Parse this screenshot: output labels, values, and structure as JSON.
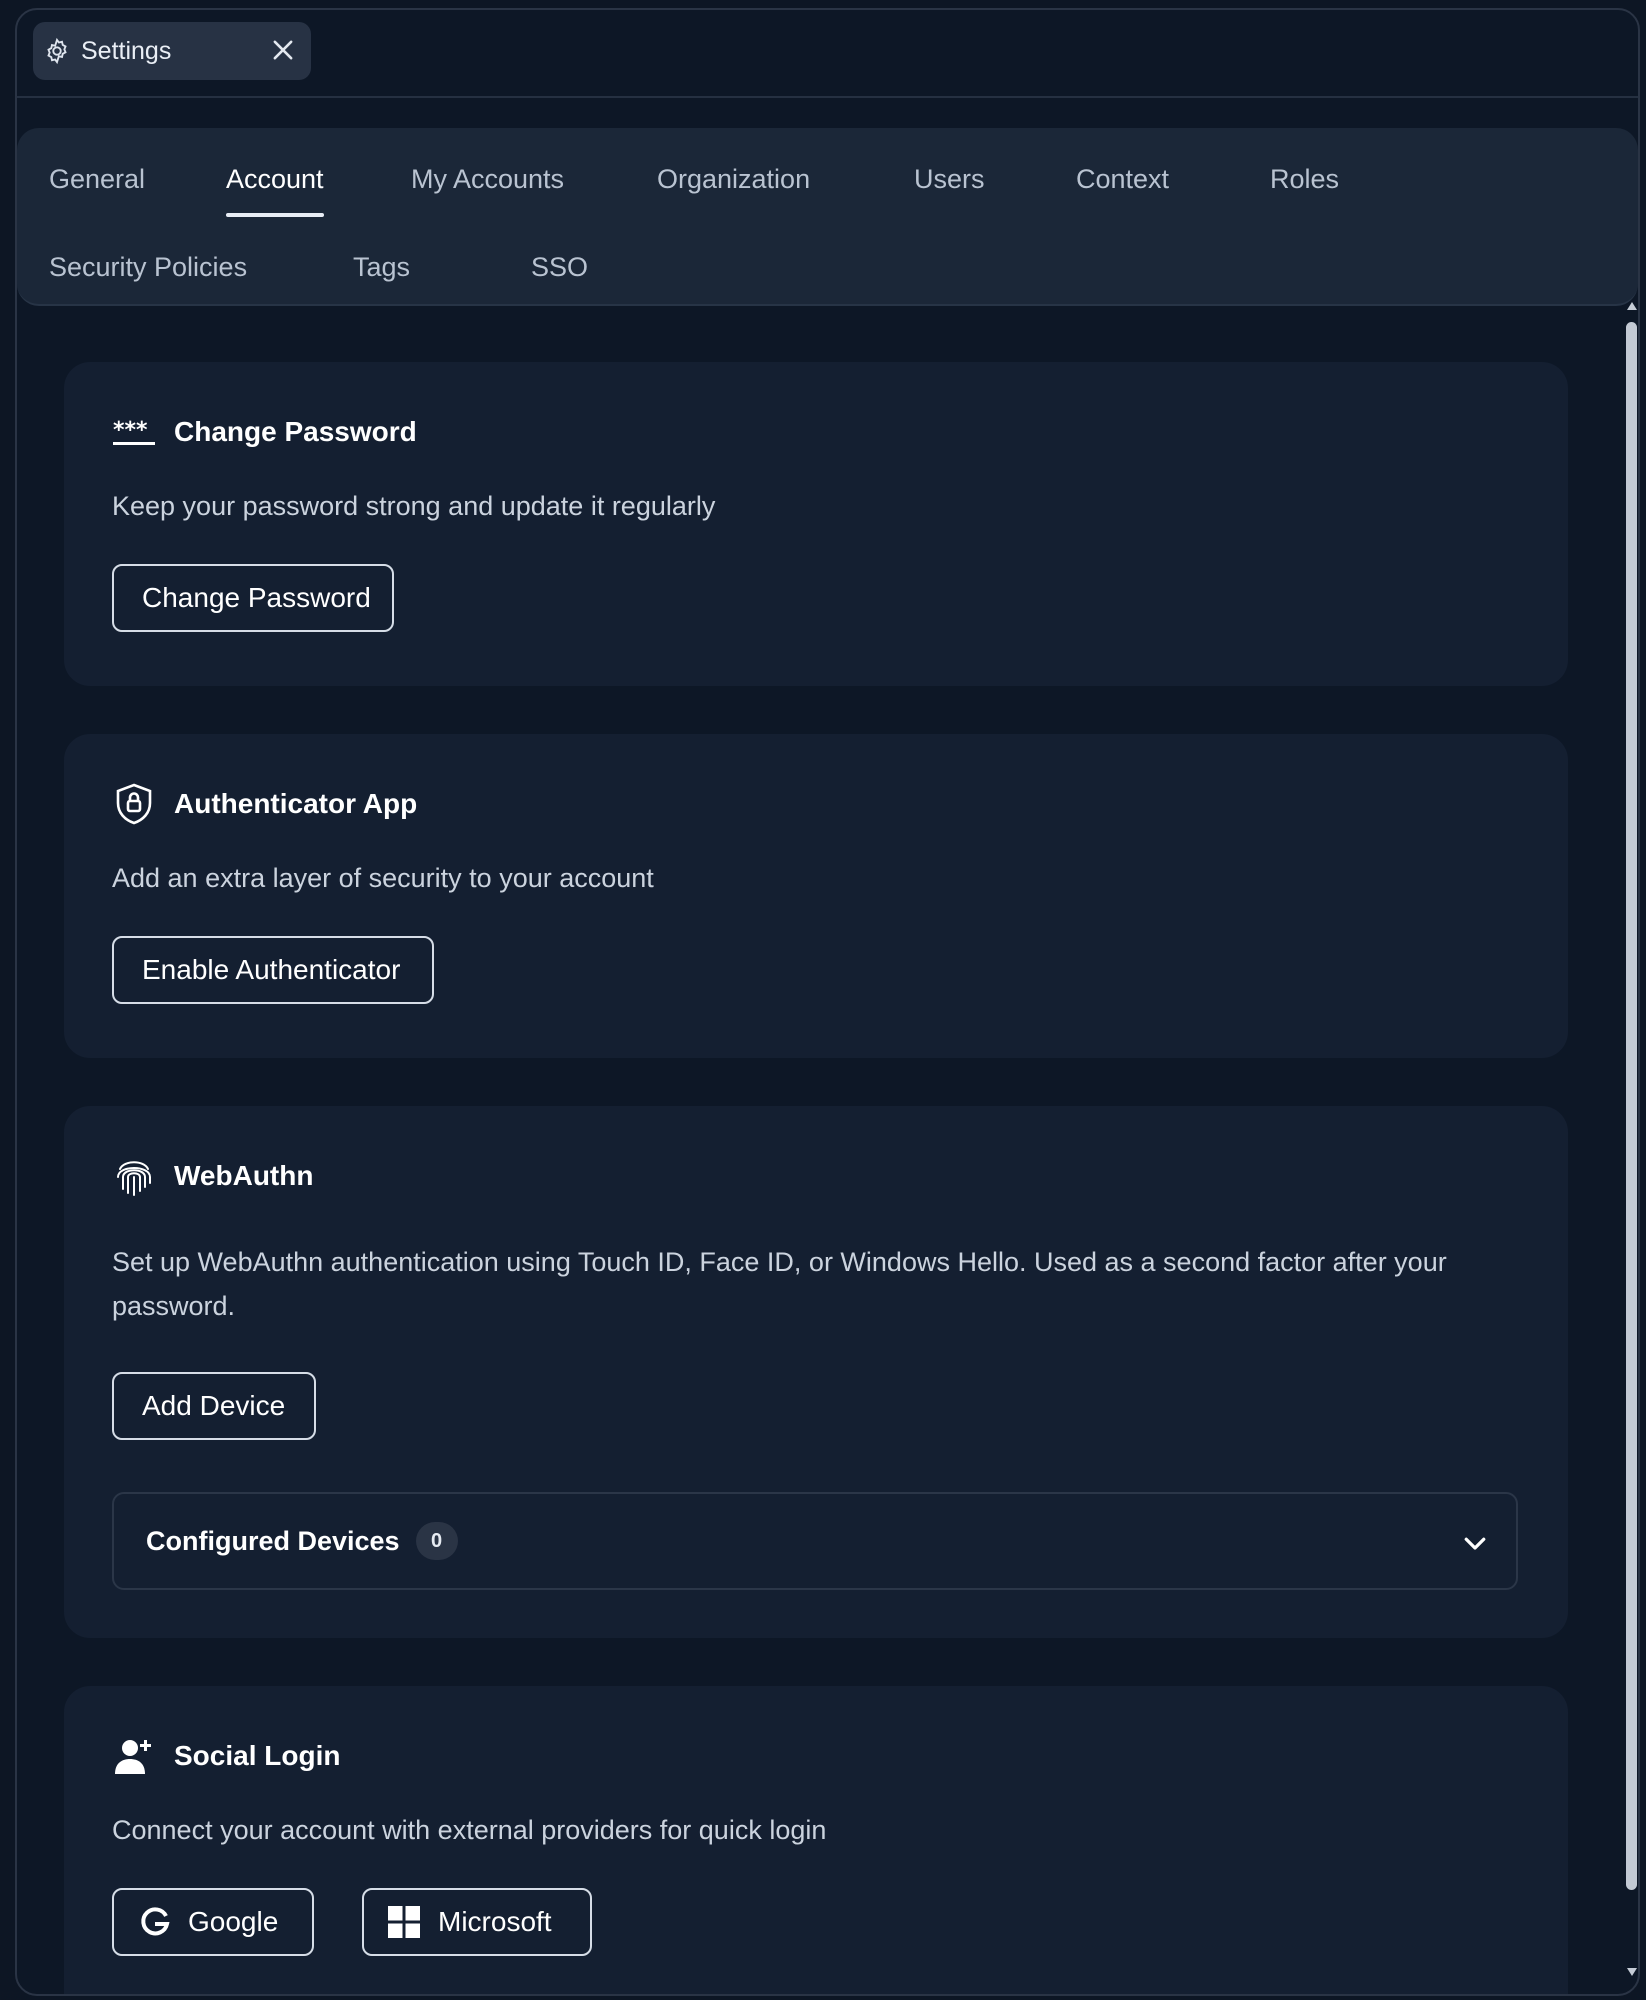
{
  "window": {
    "tab_title": "Settings",
    "tab_icon": "gear-icon",
    "close_icon": "close-icon"
  },
  "nav": {
    "tabs": [
      {
        "label": "General",
        "active": false
      },
      {
        "label": "Account",
        "active": true
      },
      {
        "label": "My Accounts",
        "active": false
      },
      {
        "label": "Organization",
        "active": false
      },
      {
        "label": "Users",
        "active": false
      },
      {
        "label": "Context",
        "active": false
      },
      {
        "label": "Roles",
        "active": false
      },
      {
        "label": "Security Policies",
        "active": false
      },
      {
        "label": "Tags",
        "active": false
      },
      {
        "label": "SSO",
        "active": false
      }
    ]
  },
  "cards": {
    "change_password": {
      "title": "Change Password",
      "description": "Keep your password strong and update it regularly",
      "button": "Change Password",
      "icon": "password-icon"
    },
    "authenticator": {
      "title": "Authenticator App",
      "description": "Add an extra layer of security to your account",
      "button": "Enable Authenticator",
      "icon": "shield-lock-icon"
    },
    "webauthn": {
      "title": "WebAuthn",
      "description": "Set up WebAuthn authentication using Touch ID, Face ID, or Windows Hello. Used as a second factor after your password.",
      "button": "Add Device",
      "icon": "fingerprint-icon",
      "devices_title": "Configured Devices",
      "devices_count": "0"
    },
    "social": {
      "title": "Social Login",
      "description": "Connect your account with external providers for quick login",
      "icon": "user-plus-icon",
      "providers": [
        {
          "label": "Google",
          "icon": "google-icon"
        },
        {
          "label": "Microsoft",
          "icon": "microsoft-icon"
        }
      ]
    }
  },
  "colors": {
    "background": "#0d1726",
    "card": "#141f31",
    "nav_panel": "#1b2738",
    "text": "#ffffff",
    "muted_text": "#cbd3de"
  }
}
